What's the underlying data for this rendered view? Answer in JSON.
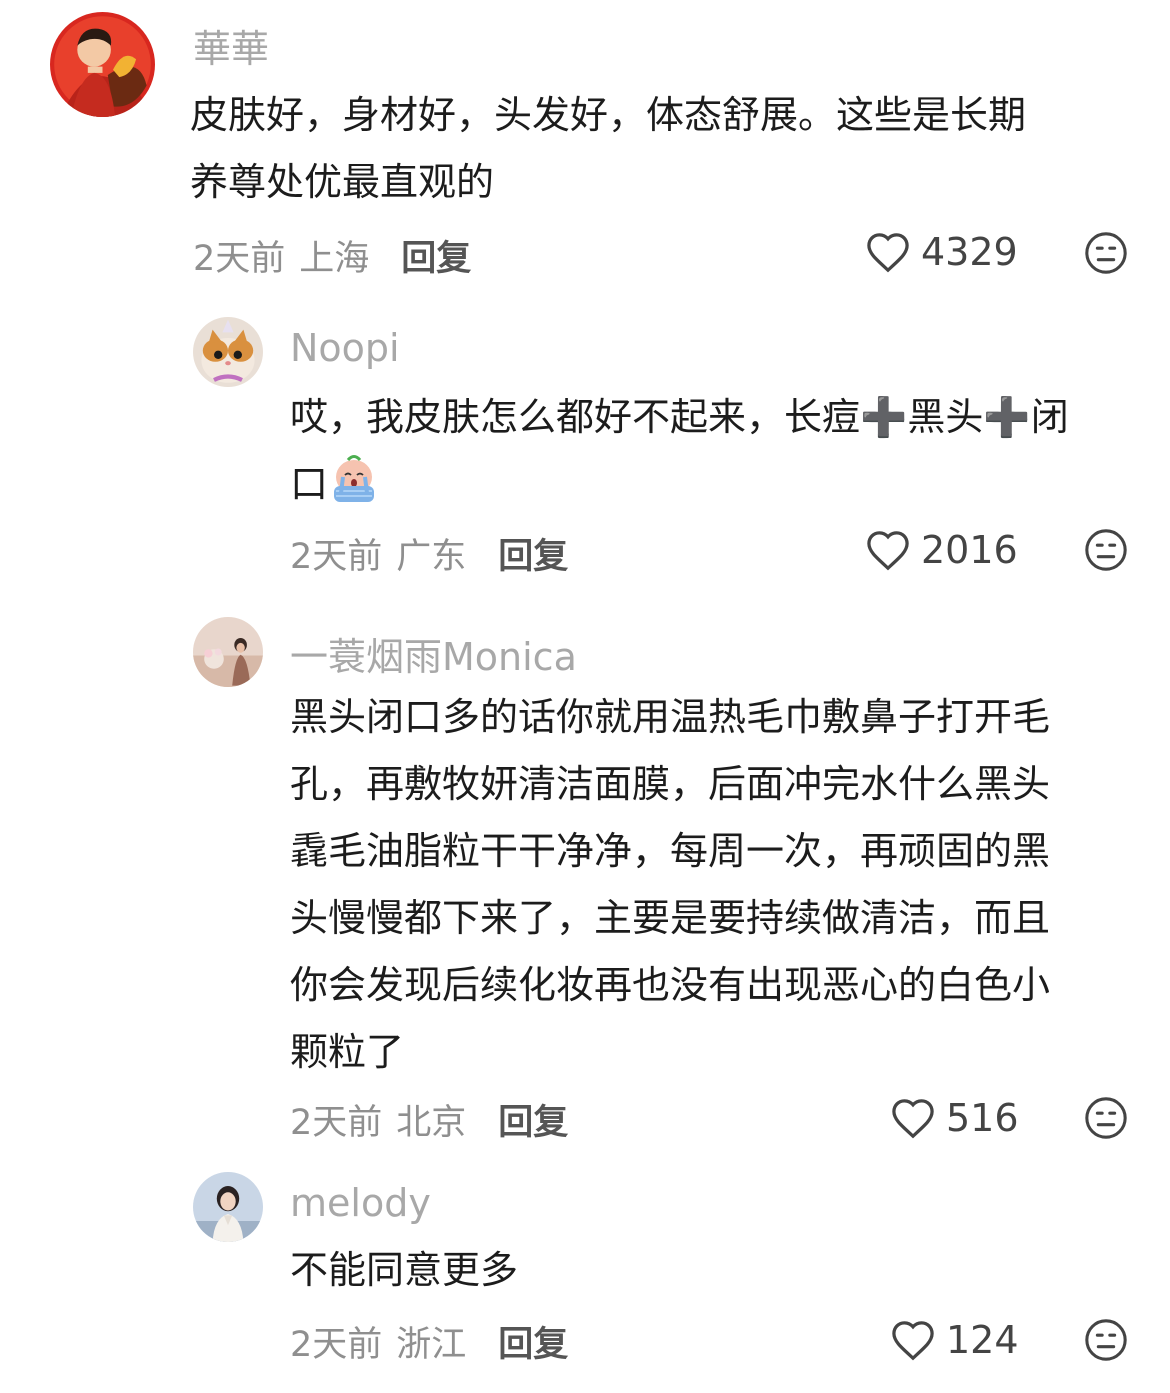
{
  "comments": [
    {
      "username": "華華",
      "lines": [
        "皮肤好，身材好，头发好，体态舒展。这些是长期",
        "养尊处优最直观的"
      ],
      "time": "2天前",
      "location": "上海",
      "reply": "回复",
      "likes": "4329"
    },
    {
      "username": "Noopi",
      "line1_a": "哎，我皮肤怎么都好不起来，长痘",
      "line1_b": "黑头",
      "line1_c": "闭",
      "line2": "口",
      "plus": "➕",
      "time": "2天前",
      "location": "广东",
      "reply": "回复",
      "likes": "2016"
    },
    {
      "username": "一蓑烟雨Monica",
      "lines": [
        "黑头闭口多的话你就用温热毛巾敷鼻子打开毛",
        "孔，再敷牧妍清洁面膜，后面冲完水什么黑头",
        "毳毛油脂粒干干净净，每周一次，再顽固的黑",
        "头慢慢都下来了，主要是要持续做清洁，而且",
        "你会发现后续化妆再也没有出现恶心的白色小",
        "颗粒了"
      ],
      "time": "2天前",
      "location": "北京",
      "reply": "回复",
      "likes": "516"
    },
    {
      "username": "melody",
      "lines": [
        "不能同意更多"
      ],
      "time": "2天前",
      "location": "浙江",
      "reply": "回复",
      "likes": "124"
    }
  ]
}
